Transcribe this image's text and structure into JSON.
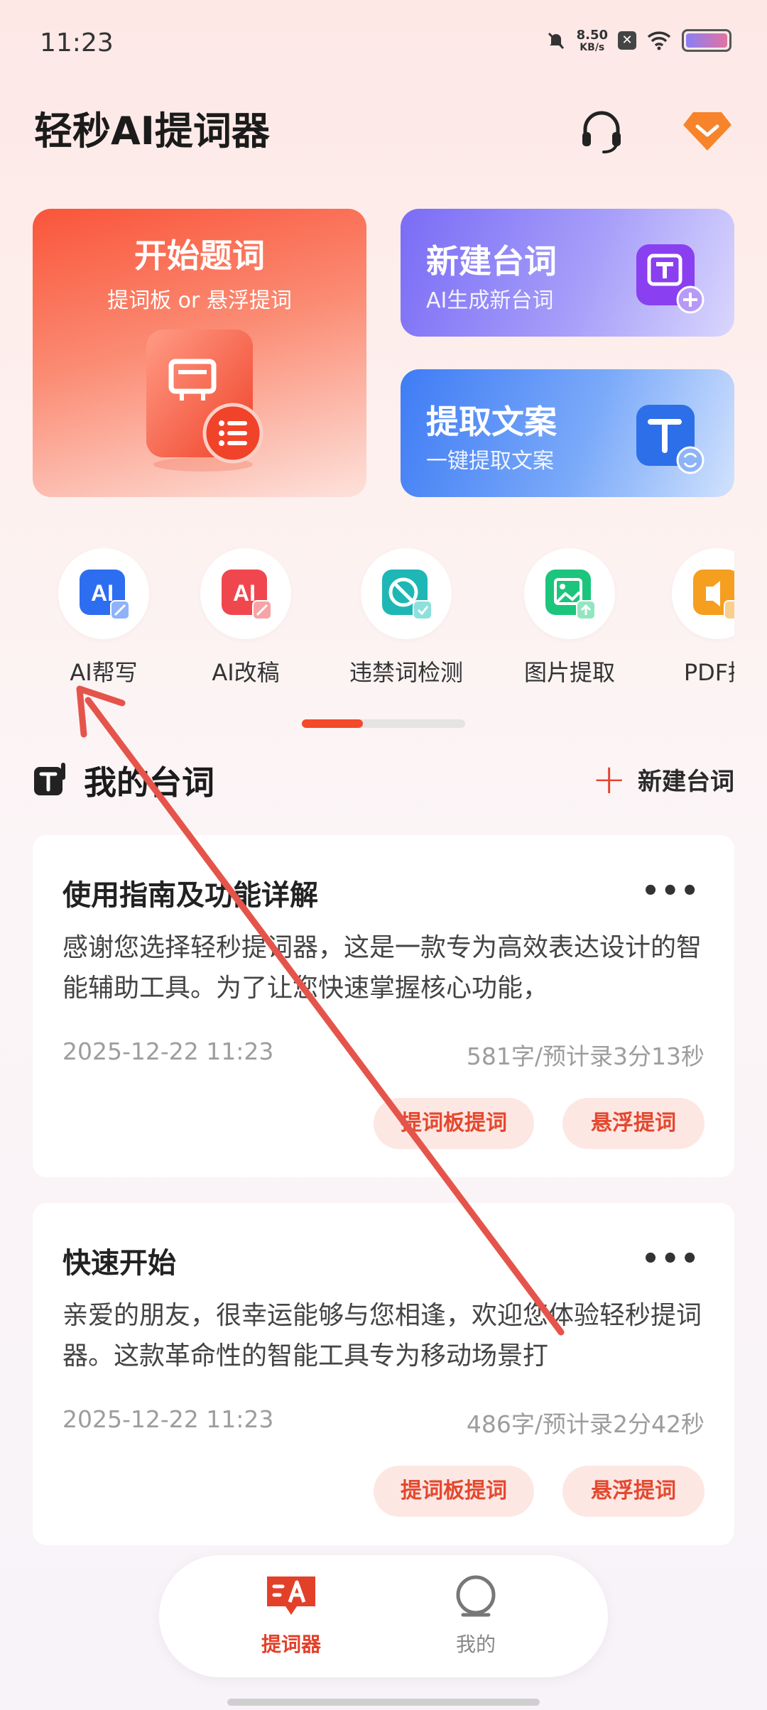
{
  "status_bar": {
    "time": "11:23",
    "net_speed_value": "8.50",
    "net_speed_unit": "KB/s",
    "icons": [
      "mute-bell-icon",
      "close-box-icon",
      "wifi-icon",
      "battery-icon"
    ]
  },
  "header": {
    "title": "轻秒AI提词器",
    "icons": [
      "headset-icon",
      "vip-diamond-icon"
    ]
  },
  "cards": {
    "start": {
      "title": "开始题词",
      "subtitle": "提词板 or 悬浮提词"
    },
    "new_script": {
      "title": "新建台词",
      "subtitle": "AI生成新台词"
    },
    "extract": {
      "title": "提取文案",
      "subtitle": "一键提取文案"
    }
  },
  "tools": [
    {
      "label": "AI帮写",
      "icon": "ai-write-icon"
    },
    {
      "label": "AI改稿",
      "icon": "ai-edit-icon"
    },
    {
      "label": "违禁词检测",
      "icon": "banned-word-check-icon"
    },
    {
      "label": "图片提取",
      "icon": "image-extract-icon"
    },
    {
      "label": "PDF提",
      "icon": "pdf-extract-icon"
    }
  ],
  "section": {
    "title": "我的台词",
    "new_label": "新建台词"
  },
  "scripts": [
    {
      "title": "使用指南及功能详解",
      "body": "感谢您选择轻秒提词器，这是一款专为高效表达设计的智能辅助工具。为了让您快速掌握核心功能，",
      "date": "2025-12-22 11:23",
      "count": "581字/预计录3分13秒",
      "more": "•••",
      "btn_board": "提词板提词",
      "btn_float": "悬浮提词"
    },
    {
      "title": "快速开始",
      "body": "亲爱的朋友，很幸运能够与您相逢，欢迎您体验轻秒提词器。这款革命性的智能工具专为移动场景打",
      "date": "2025-12-22 11:23",
      "count": "486字/预计录2分42秒",
      "more": "•••",
      "btn_board": "提词板提词",
      "btn_float": "悬浮提词"
    }
  ],
  "tabbar": {
    "tabs": [
      {
        "label": "提词器",
        "icon": "teleprompter-icon",
        "active": true
      },
      {
        "label": "我的",
        "icon": "profile-icon",
        "active": false
      }
    ]
  },
  "colors": {
    "accent": "#e3402a",
    "annotation_arrow": "#e5544b"
  }
}
